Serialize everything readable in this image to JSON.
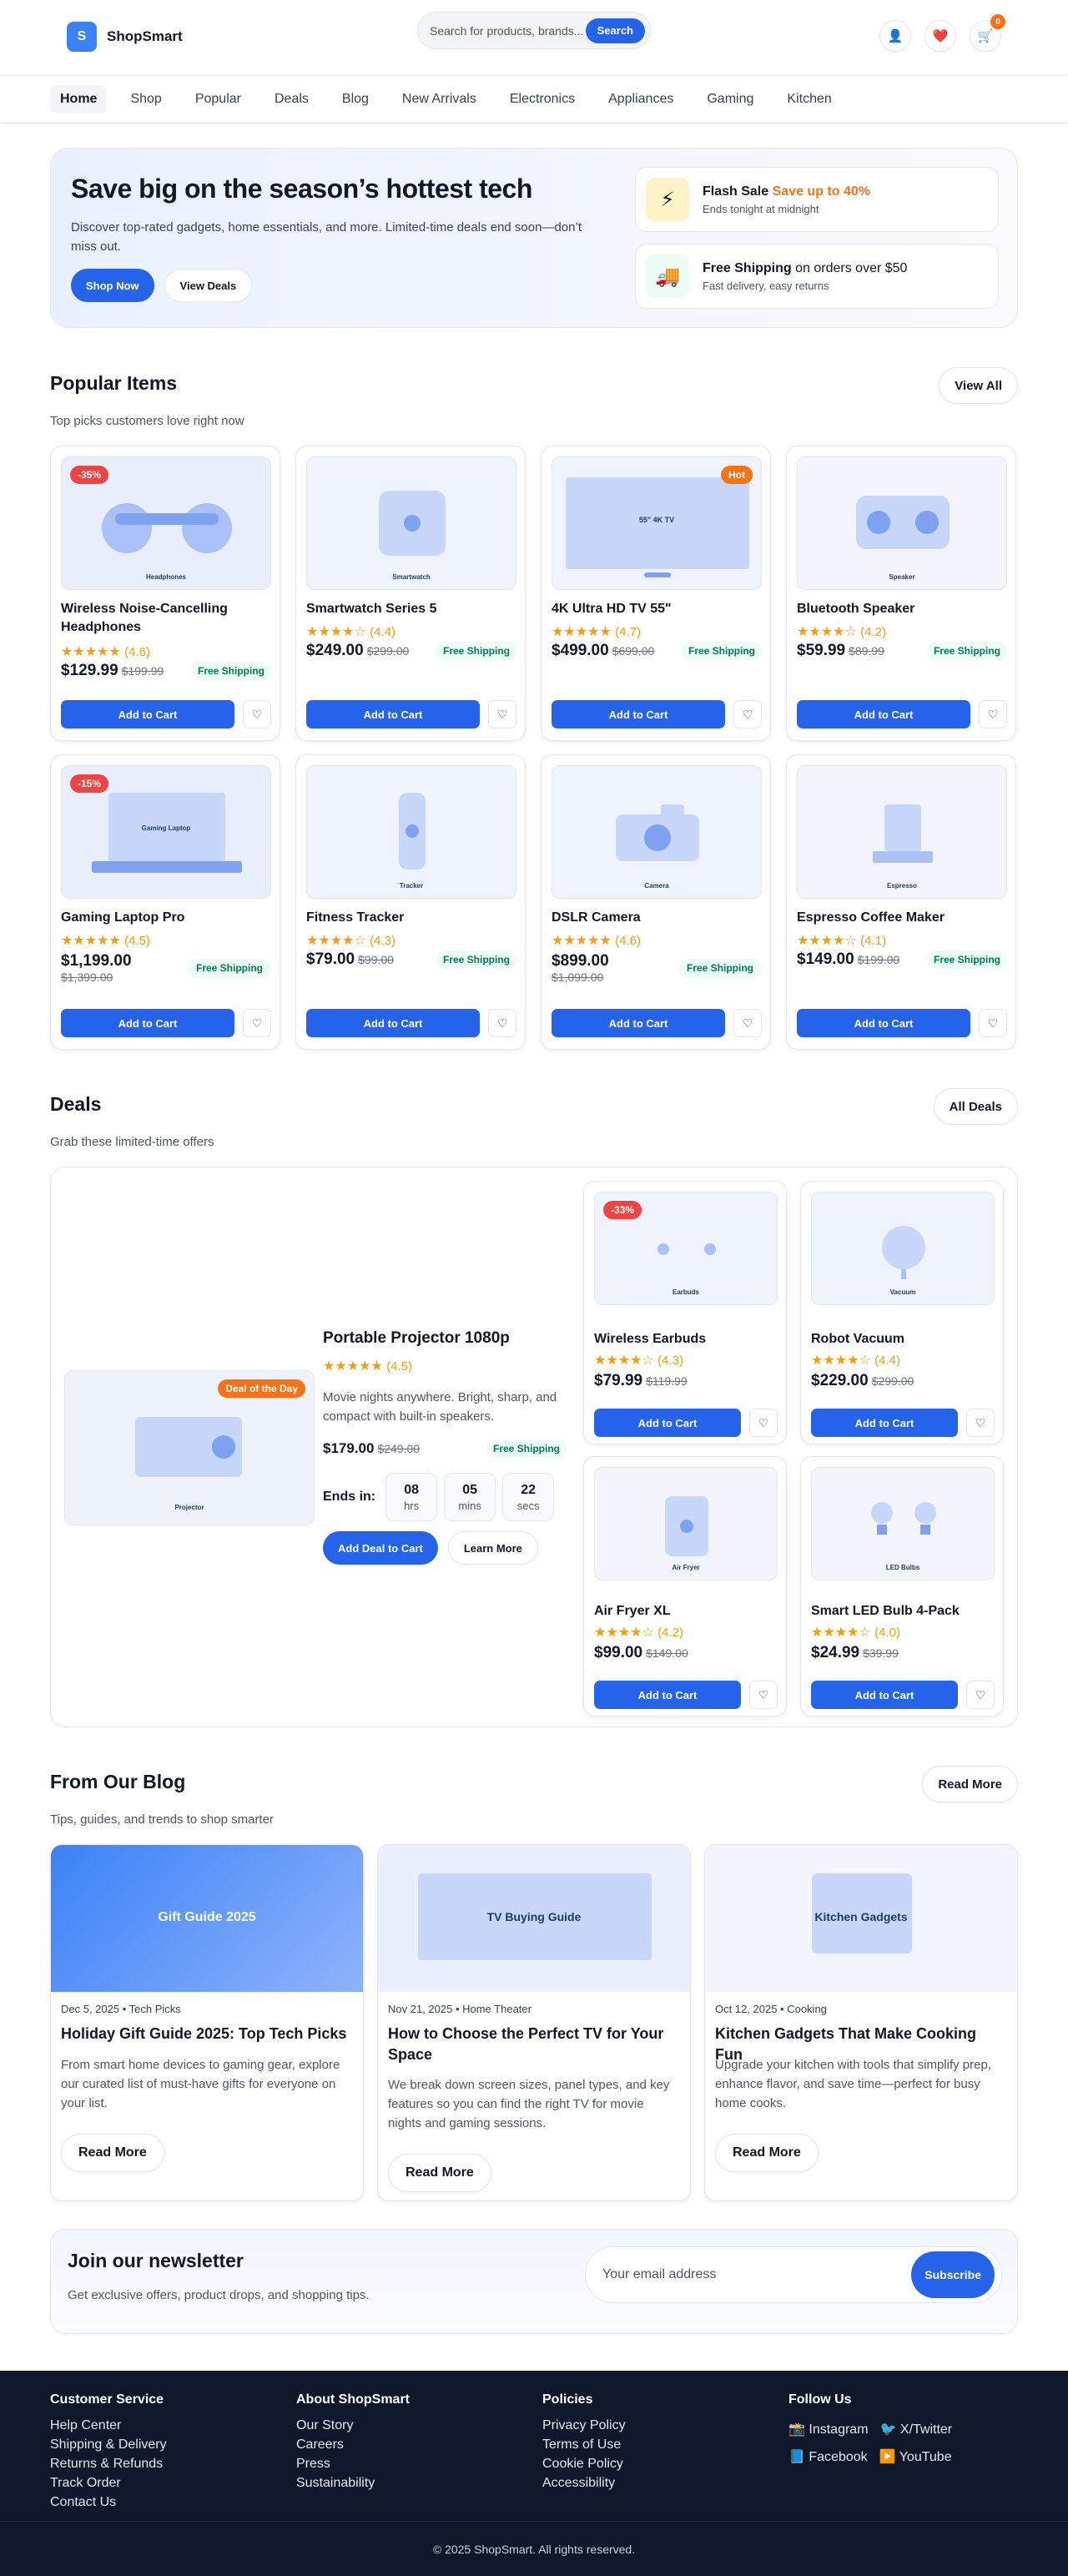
{
  "brand": {
    "initial": "S",
    "name": "ShopSmart"
  },
  "search": {
    "placeholder": "Search for products, brands...",
    "button": "Search"
  },
  "header": {
    "cart_count": "0"
  },
  "nav": [
    "Home",
    "Shop",
    "Popular",
    "Deals",
    "Blog",
    "New Arrivals",
    "Electronics",
    "Appliances",
    "Gaming",
    "Kitchen"
  ],
  "hero": {
    "title": "Save big on the season’s hottest tech",
    "subtitle": "Discover top-rated gadgets, home essentials, and more. Limited-time deals end soon—don’t miss out.",
    "primary": "Shop Now",
    "secondary": "View Deals",
    "promo1": {
      "title": "Flash Sale",
      "highlight": "Save up to 40%",
      "sub": "Ends tonight at midnight"
    },
    "promo2": {
      "title": "Free Shipping",
      "rest": "on orders over $50",
      "sub": "Fast delivery, easy returns"
    }
  },
  "popular": {
    "title": "Popular Items",
    "subtitle": "Top picks customers love right now",
    "button": "View All",
    "add_label": "Add to Cart",
    "items": [
      {
        "name": "Wireless Noise-Cancelling Headphones",
        "img": "Headphones",
        "stars": "★★★★★",
        "rating": "(4.6)",
        "price": "$129.99",
        "old": "$199.99",
        "ship": "Free Shipping",
        "badge": "-35%"
      },
      {
        "name": "Smartwatch Series 5",
        "img": "Smartwatch",
        "stars": "★★★★☆",
        "rating": "(4.4)",
        "price": "$249.00",
        "old": "$299.00",
        "ship": "Free Shipping"
      },
      {
        "name": "4K Ultra HD TV 55\"",
        "img": "55\" 4K TV",
        "stars": "★★★★★",
        "rating": "(4.7)",
        "price": "$499.00",
        "old": "$699.00",
        "ship": "Free Shipping",
        "badge": "Hot"
      },
      {
        "name": "Bluetooth Speaker",
        "img": "Speaker",
        "stars": "★★★★☆",
        "rating": "(4.2)",
        "price": "$59.99",
        "old": "$89.99",
        "ship": "Free Shipping"
      },
      {
        "name": "Gaming Laptop Pro",
        "img": "Gaming Laptop",
        "stars": "★★★★★",
        "rating": "(4.5)",
        "price": "$1,199.00",
        "old": "$1,399.00",
        "ship": "Free Shipping",
        "badge": "-15%"
      },
      {
        "name": "Fitness Tracker",
        "img": "Tracker",
        "stars": "★★★★☆",
        "rating": "(4.3)",
        "price": "$79.00",
        "old": "$99.00",
        "ship": "Free Shipping"
      },
      {
        "name": "DSLR Camera",
        "img": "Camera",
        "stars": "★★★★★",
        "rating": "(4.6)",
        "price": "$899.00",
        "old": "$1,099.00",
        "ship": "Free Shipping"
      },
      {
        "name": "Espresso Coffee Maker",
        "img": "Espresso",
        "stars": "★★★★☆",
        "rating": "(4.1)",
        "price": "$149.00",
        "old": "$199.00",
        "ship": "Free Shipping"
      }
    ]
  },
  "deals": {
    "title": "Deals",
    "subtitle": "Grab these limited-time offers",
    "button": "All Deals",
    "featured": {
      "badge": "Deal of the Day",
      "img": "Projector",
      "name": "Portable Projector 1080p",
      "stars": "★★★★★",
      "rating": "(4.5)",
      "desc": "Movie nights anywhere. Bright, sharp, and compact with built-in speakers.",
      "price": "$179.00",
      "old": "$249.00",
      "ship": "Free Shipping",
      "ends_label": "Ends in:",
      "countdown": [
        {
          "n": "08",
          "u": "hrs"
        },
        {
          "n": "05",
          "u": "mins"
        },
        {
          "n": "22",
          "u": "secs"
        }
      ],
      "primary": "Add Deal to Cart",
      "secondary": "Learn More"
    },
    "items": [
      {
        "name": "Wireless Earbuds",
        "img": "Earbuds",
        "stars": "★★★★☆",
        "rating": "(4.3)",
        "price": "$79.99",
        "old": "$119.99",
        "badge": "-33%"
      },
      {
        "name": "Robot Vacuum",
        "img": "Vacuum",
        "stars": "★★★★☆",
        "rating": "(4.4)",
        "price": "$229.00",
        "old": "$299.00"
      },
      {
        "name": "Air Fryer XL",
        "img": "Air Fryer",
        "stars": "★★★★☆",
        "rating": "(4.2)",
        "price": "$99.00",
        "old": "$149.00"
      },
      {
        "name": "Smart LED Bulb 4-Pack",
        "img": "LED Bulbs",
        "stars": "★★★★☆",
        "rating": "(4.0)",
        "price": "$24.99",
        "old": "$39.99"
      }
    ]
  },
  "blog": {
    "title": "From Our Blog",
    "subtitle": "Tips, guides, and trends to shop smarter",
    "button": "Read More",
    "read_label": "Read More",
    "posts": [
      {
        "img": "Gift Guide 2025",
        "meta": "Dec 5, 2025 • Tech Picks",
        "title": "Holiday Gift Guide 2025: Top Tech Picks",
        "excerpt": "From smart home devices to gaming gear, explore our curated list of must-have gifts for everyone on your list."
      },
      {
        "img": "TV Buying Guide",
        "meta": "Nov 21, 2025 • Home Theater",
        "title": "How to Choose the Perfect TV for Your Space",
        "excerpt": "We break down screen sizes, panel types, and key features so you can find the right TV for movie nights and gaming sessions."
      },
      {
        "img": "Kitchen Gadgets",
        "meta": "Oct 12, 2025 • Cooking",
        "title": "Kitchen Gadgets That Make Cooking Fun",
        "excerpt": "Upgrade your kitchen with tools that simplify prep, enhance flavor, and save time—perfect for busy home cooks."
      }
    ]
  },
  "newsletter": {
    "title": "Join our newsletter",
    "subtitle": "Get exclusive offers, product drops, and shopping tips.",
    "placeholder": "Your email address",
    "button": "Subscribe"
  },
  "footer": {
    "cols": [
      {
        "title": "Customer Service",
        "links": [
          "Help Center",
          "Shipping & Delivery",
          "Returns & Refunds",
          "Track Order",
          "Contact Us"
        ]
      },
      {
        "title": "About ShopSmart",
        "links": [
          "Our Story",
          "Careers",
          "Press",
          "Sustainability"
        ]
      },
      {
        "title": "Policies",
        "links": [
          "Privacy Policy",
          "Terms of Use",
          "Cookie Policy",
          "Accessibility"
        ]
      }
    ],
    "follow": {
      "title": "Follow Us",
      "instagram": "Instagram",
      "twitter": "X/Twitter",
      "facebook": "Facebook",
      "youtube": "YouTube"
    },
    "copyright": "© 2025 ShopSmart. All rights reserved."
  },
  "colors": {
    "primary": "#2563eb",
    "accent": "#f97316",
    "sale": "#ef4444",
    "star": "#f59e0b",
    "footer": "#0f172a"
  }
}
